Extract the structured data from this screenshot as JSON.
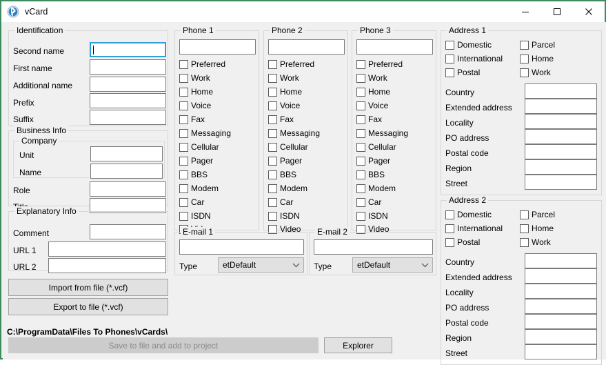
{
  "window": {
    "title": "vCard",
    "icon": "bluetooth-icon",
    "border_color": "#3d8a5f",
    "controls": {
      "minimize": "–",
      "maximize": "☐",
      "close": "✕"
    }
  },
  "identification": {
    "title": "Identification",
    "fields": [
      {
        "label": "Second name",
        "value": "",
        "focused": true
      },
      {
        "label": "First name",
        "value": "",
        "focused": false
      },
      {
        "label": "Additional name",
        "value": "",
        "focused": false
      },
      {
        "label": "Prefix",
        "value": "",
        "focused": false
      },
      {
        "label": "Suffix",
        "value": "",
        "focused": false
      }
    ]
  },
  "business_info": {
    "title": "Business Info",
    "company": {
      "title": "Company",
      "fields": [
        {
          "label": "Unit",
          "value": ""
        },
        {
          "label": "Name",
          "value": ""
        }
      ]
    },
    "fields": [
      {
        "label": "Role",
        "value": ""
      },
      {
        "label": "Title",
        "value": ""
      }
    ]
  },
  "explanatory_info": {
    "title": "Explanatory Info",
    "fields": [
      {
        "label": "Comment",
        "value": ""
      },
      {
        "label": "URL 1",
        "value": ""
      },
      {
        "label": "URL 2",
        "value": ""
      }
    ]
  },
  "file_actions": {
    "import_label": "Import from file (*.vcf)",
    "export_label": "Export to file (*.vcf)",
    "path": "C:\\ProgramData\\Files To Phones\\vCards\\",
    "save_label": "Save to file and add to project",
    "save_enabled": false,
    "explorer_label": "Explorer"
  },
  "phones": [
    {
      "title": "Phone 1",
      "number": "",
      "options": [
        "Preferred",
        "Work",
        "Home",
        "Voice",
        "Fax",
        "Messaging",
        "Cellular",
        "Pager",
        "BBS",
        "Modem",
        "Car",
        "ISDN",
        "Video"
      ]
    },
    {
      "title": "Phone 2",
      "number": "",
      "options": [
        "Preferred",
        "Work",
        "Home",
        "Voice",
        "Fax",
        "Messaging",
        "Cellular",
        "Pager",
        "BBS",
        "Modem",
        "Car",
        "ISDN",
        "Video"
      ]
    },
    {
      "title": "Phone 3",
      "number": "",
      "options": [
        "Preferred",
        "Work",
        "Home",
        "Voice",
        "Fax",
        "Messaging",
        "Cellular",
        "Pager",
        "BBS",
        "Modem",
        "Car",
        "ISDN",
        "Video"
      ]
    }
  ],
  "emails": [
    {
      "title": "E-mail 1",
      "value": "",
      "type_label": "Type",
      "type_value": "etDefault"
    },
    {
      "title": "E-mail 2",
      "value": "",
      "type_label": "Type",
      "type_value": "etDefault"
    }
  ],
  "addresses": [
    {
      "title": "Address 1",
      "checkboxes_left": [
        "Domestic",
        "International",
        "Postal"
      ],
      "checkboxes_right": [
        "Parcel",
        "Home",
        "Work"
      ],
      "fields": [
        {
          "label": "Country",
          "value": ""
        },
        {
          "label": "Extended address",
          "value": ""
        },
        {
          "label": "Locality",
          "value": ""
        },
        {
          "label": "PO address",
          "value": ""
        },
        {
          "label": "Postal code",
          "value": ""
        },
        {
          "label": "Region",
          "value": ""
        },
        {
          "label": "Street",
          "value": ""
        }
      ]
    },
    {
      "title": "Address 2",
      "checkboxes_left": [
        "Domestic",
        "International",
        "Postal"
      ],
      "checkboxes_right": [
        "Parcel",
        "Home",
        "Work"
      ],
      "fields": [
        {
          "label": "Country",
          "value": ""
        },
        {
          "label": "Extended address",
          "value": ""
        },
        {
          "label": "Locality",
          "value": ""
        },
        {
          "label": "PO address",
          "value": ""
        },
        {
          "label": "Postal code",
          "value": ""
        },
        {
          "label": "Region",
          "value": ""
        },
        {
          "label": "Street",
          "value": ""
        }
      ]
    }
  ]
}
